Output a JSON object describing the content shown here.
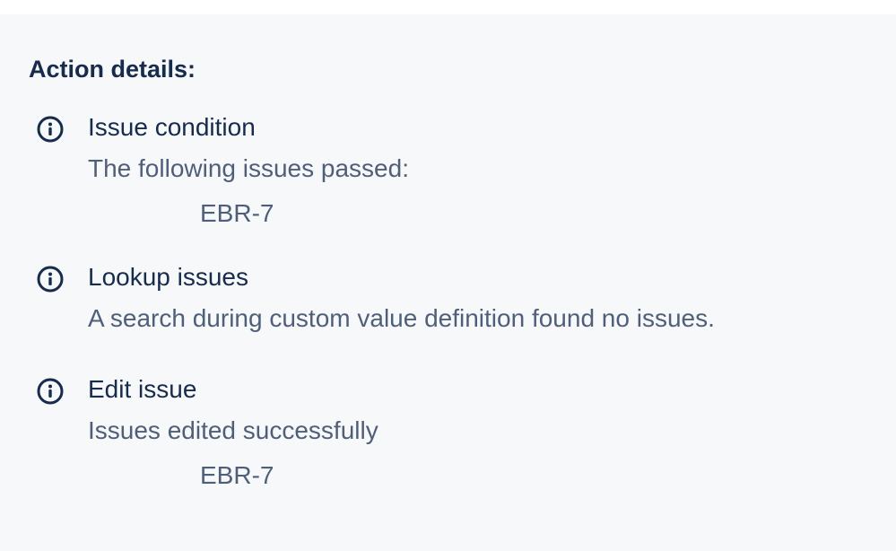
{
  "panel": {
    "heading": "Action details:"
  },
  "actions": [
    {
      "icon": "info-icon",
      "title": "Issue condition",
      "description": "The following issues passed:",
      "issue": "EBR-7"
    },
    {
      "icon": "info-icon",
      "title": "Lookup issues",
      "description": "A search during custom value definition found no issues."
    },
    {
      "icon": "info-icon",
      "title": "Edit issue",
      "description": "Issues edited successfully",
      "issue": "EBR-7"
    }
  ]
}
